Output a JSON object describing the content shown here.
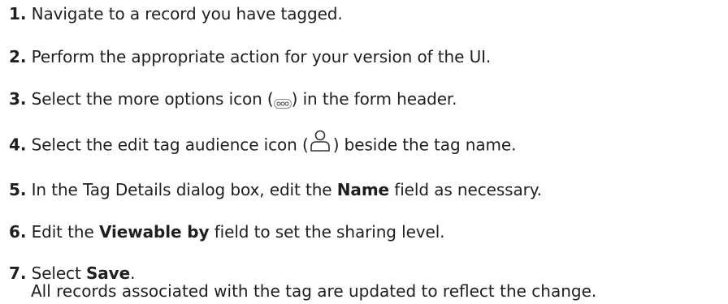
{
  "steps": [
    {
      "number": "1.",
      "parts": [
        "Navigate to a record you have tagged."
      ]
    },
    {
      "number": "2.",
      "parts": [
        "Perform the appropriate action for your version of the UI."
      ]
    },
    {
      "number": "3.",
      "parts": [
        "Select the more options icon (",
        ") in the form header."
      ],
      "icon": "more-options-icon"
    },
    {
      "number": "4.",
      "parts": [
        "Select the edit tag audience icon (",
        ") beside the tag name."
      ],
      "icon": "edit-tag-audience-icon"
    },
    {
      "number": "5.",
      "parts": [
        "In the Tag Details dialog box, edit the ",
        "Name",
        " field as necessary."
      ]
    },
    {
      "number": "6.",
      "parts": [
        "Edit the ",
        "Viewable by",
        " field to set the sharing level."
      ]
    },
    {
      "number": "7.",
      "parts": [
        "Select ",
        "Save",
        "."
      ]
    }
  ],
  "result_text": "All records associated with the tag are updated to reflect the change."
}
